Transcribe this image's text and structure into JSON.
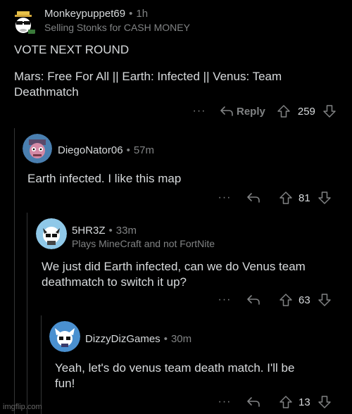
{
  "comments": [
    {
      "username": "Monkeypuppet69",
      "time": "1h",
      "flair": "Selling Stonks for CASH MONEY",
      "body_line1": "VOTE NEXT ROUND",
      "body_line2": "Mars: Free For All  ||  Earth: Infected  ||  Venus: Team",
      "body_line3": "Deathmatch",
      "reply_label": "Reply",
      "votes": "259"
    },
    {
      "username": "DiegoNator06",
      "time": "57m",
      "body_line1": "Earth infected. I like this map",
      "votes": "81"
    },
    {
      "username": "5HR3Z",
      "time": "33m",
      "flair": "Plays MineCraft and not FortNite",
      "body_line1": "We just did Earth infected, can we do Venus team",
      "body_line2": "deathmatch to switch it up?",
      "votes": "63"
    },
    {
      "username": "DizzyDizGames",
      "time": "30m",
      "body_line1": "Yeah, let's do venus team death match. I'll be",
      "body_line2": "fun!",
      "votes": "13"
    }
  ],
  "watermark": "imgflip.com",
  "colors": {
    "background": "#000000",
    "text": "#d7dadc",
    "muted": "#818384",
    "thread": "#343536"
  },
  "icons": [
    "more-icon",
    "reply-arrow-icon",
    "upvote-arrow-icon",
    "downvote-arrow-icon"
  ]
}
